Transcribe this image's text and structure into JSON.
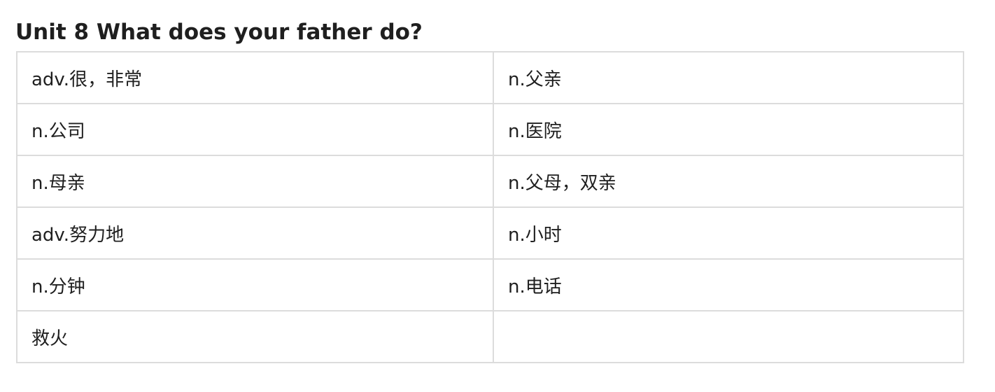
{
  "title": "Unit 8 What does your father do?",
  "rows": [
    [
      "adv.很，非常",
      "n.父亲"
    ],
    [
      "n.公司",
      "n.医院"
    ],
    [
      "n.母亲",
      "n.父母，双亲"
    ],
    [
      "adv.努力地",
      "n.小时"
    ],
    [
      "n.分钟",
      "n.电话"
    ],
    [
      "救火",
      ""
    ]
  ]
}
